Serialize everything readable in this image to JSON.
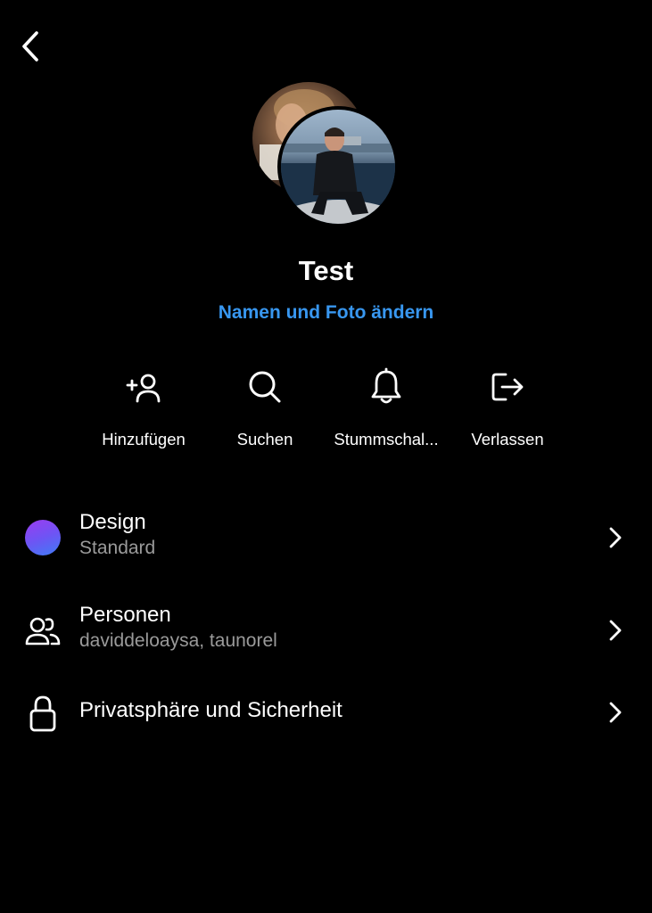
{
  "header": {
    "back_icon": "chevron-left-icon"
  },
  "group": {
    "title": "Test",
    "edit_label": "Namen und Foto ändern"
  },
  "actions": [
    {
      "label": "Hinzufügen",
      "icon": "add-person-icon"
    },
    {
      "label": "Suchen",
      "icon": "search-icon"
    },
    {
      "label": "Stummschal...",
      "icon": "bell-icon"
    },
    {
      "label": "Verlassen",
      "icon": "leave-icon"
    }
  ],
  "settings": [
    {
      "title": "Design",
      "subtitle": "Standard",
      "icon": "theme-color-dot"
    },
    {
      "title": "Personen",
      "subtitle": "daviddeloaysa, taunorel",
      "icon": "people-icon"
    },
    {
      "title": "Privatsphäre und Sicherheit",
      "icon": "lock-icon"
    }
  ],
  "colors": {
    "background": "#000000",
    "accent_link": "#3897f0",
    "secondary_text": "#9a9a9a",
    "theme_gradient": [
      "#9b3cf0",
      "#3f7cf6"
    ]
  }
}
